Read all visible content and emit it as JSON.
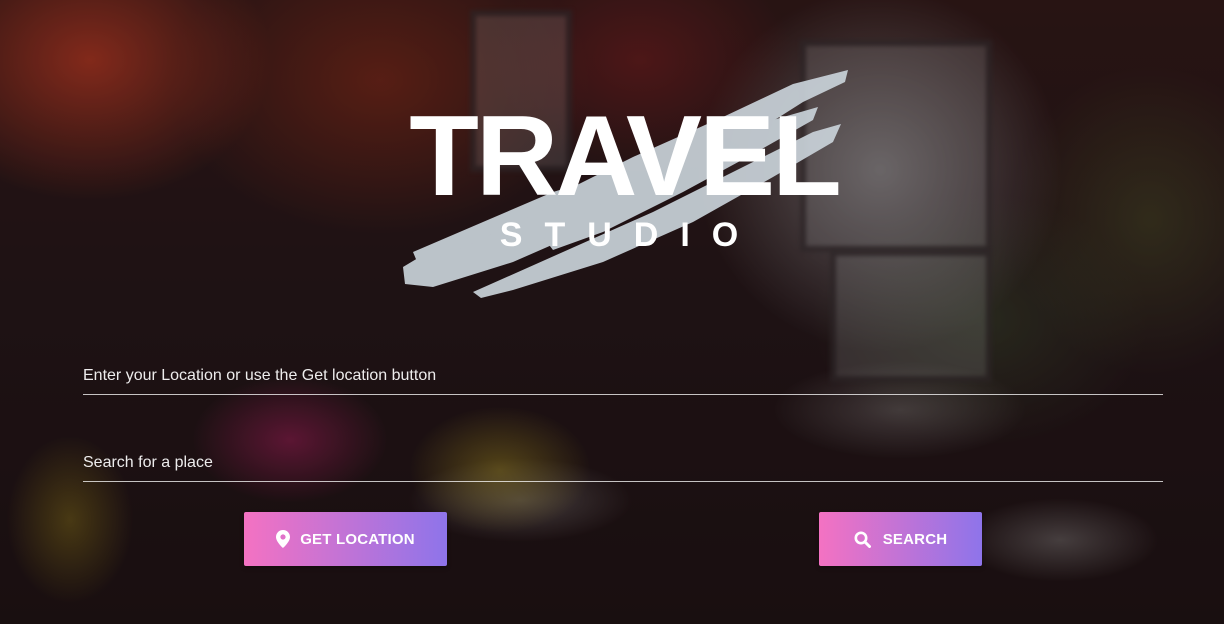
{
  "logo": {
    "title": "TRAVEL",
    "subtitle": "STUDIO"
  },
  "form": {
    "location_placeholder": "Enter your Location or use the Get location button",
    "location_value": "",
    "search_placeholder": "Search for a place",
    "search_value": ""
  },
  "buttons": {
    "get_location": {
      "label": "GET LOCATION",
      "icon": "map-pin-icon"
    },
    "search": {
      "label": "SEARCH",
      "icon": "search-icon"
    }
  },
  "colors": {
    "button_gradient_start": "#f472c2",
    "button_gradient_end": "#8e74ea",
    "brush_stroke": "#c9d2d9",
    "text": "#ffffff"
  }
}
